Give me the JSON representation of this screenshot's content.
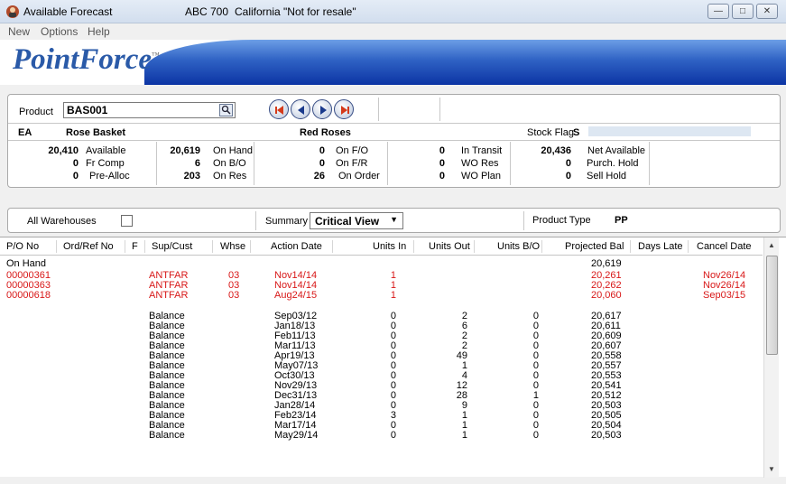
{
  "window": {
    "title": "Available Forecast",
    "company": "ABC 700",
    "region": "California \"Not for resale\""
  },
  "menu": [
    "New",
    "Options",
    "Help"
  ],
  "brand": {
    "logo": "PointForce",
    "tm": "™"
  },
  "product": {
    "label": "Product",
    "value": "BAS001",
    "uom": "EA",
    "name": "Rose Basket",
    "category": "Red Roses",
    "stock_flag_label": "Stock Flag",
    "stock_flag_value": "S"
  },
  "stats": {
    "available": {
      "value": "20,410",
      "label": "Available"
    },
    "fr_comp": {
      "value": "0",
      "label": "Fr Comp"
    },
    "pre_alloc": {
      "value": "0",
      "label": "Pre-Alloc"
    },
    "on_hand": {
      "value": "20,619",
      "label": "On Hand"
    },
    "on_bo": {
      "value": "6",
      "label": "On B/O"
    },
    "on_res": {
      "value": "203",
      "label": "On Res"
    },
    "on_fo": {
      "value": "0",
      "label": "On F/O"
    },
    "on_fr": {
      "value": "0",
      "label": "On F/R"
    },
    "on_order": {
      "value": "26",
      "label": "On Order"
    },
    "in_transit": {
      "value": "0",
      "label": "In Transit"
    },
    "wo_res": {
      "value": "0",
      "label": "WO Res"
    },
    "wo_plan": {
      "value": "0",
      "label": "WO Plan"
    },
    "net_available": {
      "value": "20,436",
      "label": "Net Available"
    },
    "purch_hold": {
      "value": "0",
      "label": "Purch. Hold"
    },
    "sell_hold": {
      "value": "0",
      "label": "Sell Hold"
    }
  },
  "filters": {
    "all_warehouses": "All Warehouses",
    "summary_label": "Summary",
    "summary_value": "Critical View",
    "product_type_label": "Product Type",
    "product_type_value": "PP"
  },
  "columns": [
    "P/O No",
    "Ord/Ref No",
    "F",
    "Sup/Cust",
    "Whse",
    "Action Date",
    "Units In",
    "Units Out",
    "Units B/O",
    "Projected Bal",
    "Days Late",
    "Cancel Date"
  ],
  "rows": [
    {
      "po": "On Hand",
      "ref": "",
      "f": "",
      "sup": "",
      "whse": "",
      "date": "",
      "in": "",
      "out": "",
      "bo": "",
      "bal": "20,619",
      "late": "",
      "cancel": "",
      "red": false
    },
    {
      "po": "00000361",
      "ref": "",
      "f": "",
      "sup": "ANTFAR",
      "whse": "03",
      "date": "Nov14/14",
      "in": "1",
      "out": "",
      "bo": "",
      "bal": "20,261",
      "late": "",
      "cancel": "Nov26/14",
      "red": true
    },
    {
      "po": "00000363",
      "ref": "",
      "f": "",
      "sup": "ANTFAR",
      "whse": "03",
      "date": "Nov14/14",
      "in": "1",
      "out": "",
      "bo": "",
      "bal": "20,262",
      "late": "",
      "cancel": "Nov26/14",
      "red": true
    },
    {
      "po": "00000618",
      "ref": "",
      "f": "",
      "sup": "ANTFAR",
      "whse": "03",
      "date": "Aug24/15",
      "in": "1",
      "out": "",
      "bo": "",
      "bal": "20,060",
      "late": "",
      "cancel": "Sep03/15",
      "red": true
    },
    {
      "po": "",
      "ref": "",
      "f": "",
      "sup": "Balance",
      "whse": "",
      "date": "Sep03/12",
      "in": "0",
      "out": "2",
      "bo": "0",
      "bal": "20,617",
      "late": "",
      "cancel": "",
      "red": false
    },
    {
      "po": "",
      "ref": "",
      "f": "",
      "sup": "Balance",
      "whse": "",
      "date": "Jan18/13",
      "in": "0",
      "out": "6",
      "bo": "0",
      "bal": "20,611",
      "late": "",
      "cancel": "",
      "red": false
    },
    {
      "po": "",
      "ref": "",
      "f": "",
      "sup": "Balance",
      "whse": "",
      "date": "Feb11/13",
      "in": "0",
      "out": "2",
      "bo": "0",
      "bal": "20,609",
      "late": "",
      "cancel": "",
      "red": false
    },
    {
      "po": "",
      "ref": "",
      "f": "",
      "sup": "Balance",
      "whse": "",
      "date": "Mar11/13",
      "in": "0",
      "out": "2",
      "bo": "0",
      "bal": "20,607",
      "late": "",
      "cancel": "",
      "red": false
    },
    {
      "po": "",
      "ref": "",
      "f": "",
      "sup": "Balance",
      "whse": "",
      "date": "Apr19/13",
      "in": "0",
      "out": "49",
      "bo": "0",
      "bal": "20,558",
      "late": "",
      "cancel": "",
      "red": false
    },
    {
      "po": "",
      "ref": "",
      "f": "",
      "sup": "Balance",
      "whse": "",
      "date": "May07/13",
      "in": "0",
      "out": "1",
      "bo": "0",
      "bal": "20,557",
      "late": "",
      "cancel": "",
      "red": false
    },
    {
      "po": "",
      "ref": "",
      "f": "",
      "sup": "Balance",
      "whse": "",
      "date": "Oct30/13",
      "in": "0",
      "out": "4",
      "bo": "0",
      "bal": "20,553",
      "late": "",
      "cancel": "",
      "red": false
    },
    {
      "po": "",
      "ref": "",
      "f": "",
      "sup": "Balance",
      "whse": "",
      "date": "Nov29/13",
      "in": "0",
      "out": "12",
      "bo": "0",
      "bal": "20,541",
      "late": "",
      "cancel": "",
      "red": false
    },
    {
      "po": "",
      "ref": "",
      "f": "",
      "sup": "Balance",
      "whse": "",
      "date": "Dec31/13",
      "in": "0",
      "out": "28",
      "bo": "1",
      "bal": "20,512",
      "late": "",
      "cancel": "",
      "red": false
    },
    {
      "po": "",
      "ref": "",
      "f": "",
      "sup": "Balance",
      "whse": "",
      "date": "Jan28/14",
      "in": "0",
      "out": "9",
      "bo": "0",
      "bal": "20,503",
      "late": "",
      "cancel": "",
      "red": false
    },
    {
      "po": "",
      "ref": "",
      "f": "",
      "sup": "Balance",
      "whse": "",
      "date": "Feb23/14",
      "in": "3",
      "out": "1",
      "bo": "0",
      "bal": "20,505",
      "late": "",
      "cancel": "",
      "red": false
    },
    {
      "po": "",
      "ref": "",
      "f": "",
      "sup": "Balance",
      "whse": "",
      "date": "Mar17/14",
      "in": "0",
      "out": "1",
      "bo": "0",
      "bal": "20,504",
      "late": "",
      "cancel": "",
      "red": false
    },
    {
      "po": "",
      "ref": "",
      "f": "",
      "sup": "Balance",
      "whse": "",
      "date": "May29/14",
      "in": "0",
      "out": "1",
      "bo": "0",
      "bal": "20,503",
      "late": "",
      "cancel": "",
      "red": false
    }
  ],
  "colors": {
    "red": "#d81818",
    "banner_blue": "#0c34a4",
    "nav_arrow": "#d43a1a"
  }
}
